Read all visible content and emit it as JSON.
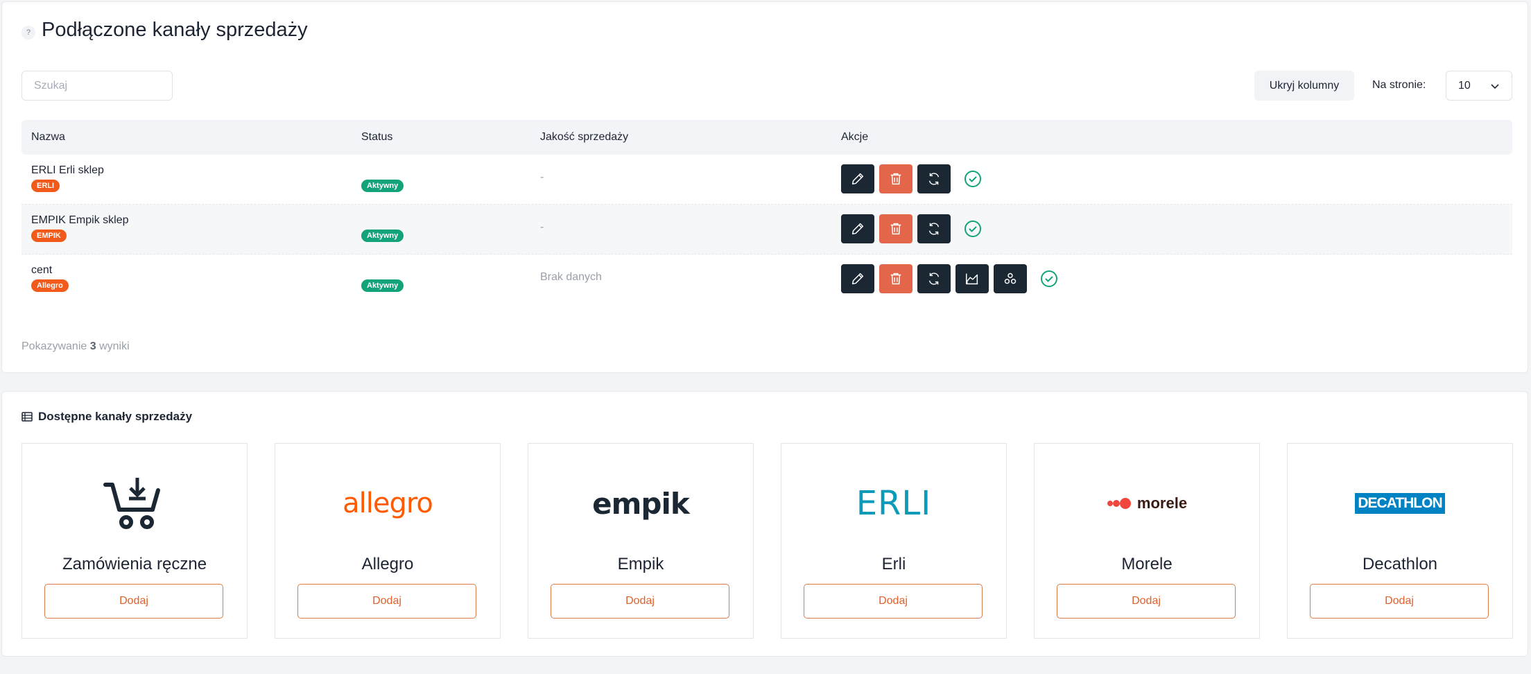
{
  "header": {
    "title": "Podłączone kanały sprzedaży",
    "help": "?"
  },
  "search": {
    "placeholder": "Szukaj"
  },
  "toolbar": {
    "hide_columns": "Ukryj kolumny",
    "per_page_label": "Na stronie:",
    "per_page_value": "10"
  },
  "table": {
    "columns": [
      "Nazwa",
      "Status",
      "Jakość sprzedaży",
      "Akcje"
    ],
    "rows": [
      {
        "name": "ERLI Erli sklep",
        "tag": "ERLI",
        "status": "Aktywny",
        "quality": "-"
      },
      {
        "name": "EMPIK Empik sklep",
        "tag": "EMPIK",
        "status": "Aktywny",
        "quality": "-"
      },
      {
        "name": "cent",
        "tag": "Allegro",
        "status": "Aktywny",
        "quality": "Brak danych"
      }
    ]
  },
  "summary": {
    "prefix": "Pokazywanie",
    "count": "3",
    "suffix": "wyniki"
  },
  "available": {
    "title": "Dostępne kanały sprzedaży",
    "add_label": "Dodaj",
    "channels": [
      {
        "name": "Zamówienia ręczne",
        "logo": "cart-icon"
      },
      {
        "name": "Allegro",
        "logo_text": "allegro"
      },
      {
        "name": "Empik",
        "logo_text": "empik"
      },
      {
        "name": "Erli",
        "logo_text": "ERLI"
      },
      {
        "name": "Morele",
        "logo_text": "morele"
      },
      {
        "name": "Decathlon",
        "logo_text": "DECATHLON"
      }
    ]
  },
  "colors": {
    "accent": "#f15a1b",
    "status_active": "#12a37b",
    "action_dark": "#1b2733",
    "action_delete": "#e3664b"
  }
}
